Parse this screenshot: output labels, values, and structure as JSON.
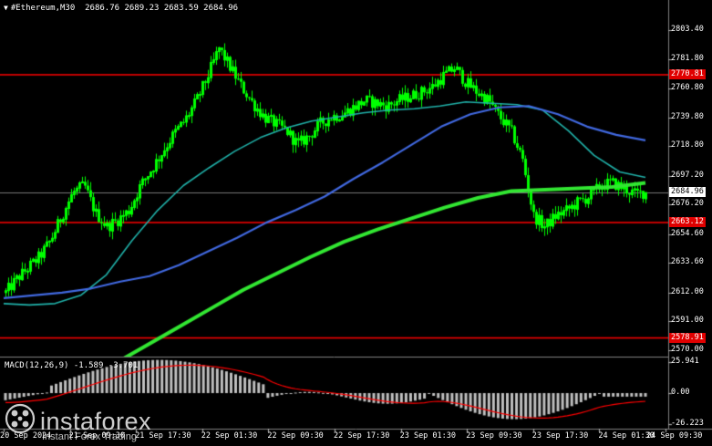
{
  "symbol_bar": {
    "symbol": "#Ethereum,M30",
    "ohlc": "2686.76 2689.23 2683.59 2684.96"
  },
  "macd": {
    "label": "MACD(12,26,9) -1.589 -3.701"
  },
  "price_axis": [
    {
      "value": 2803.4,
      "label": "2803.40"
    },
    {
      "value": 2781.8,
      "label": "2781.80"
    },
    {
      "value": 2760.8,
      "label": "2760.80"
    },
    {
      "value": 2739.8,
      "label": "2739.80"
    },
    {
      "value": 2718.8,
      "label": "2718.80"
    },
    {
      "value": 2697.2,
      "label": "2697.20"
    },
    {
      "value": 2676.2,
      "label": "2676.20"
    },
    {
      "value": 2654.6,
      "label": "2654.60"
    },
    {
      "value": 2633.6,
      "label": "2633.60"
    },
    {
      "value": 2612.0,
      "label": "2612.00"
    },
    {
      "value": 2591.0,
      "label": "2591.00"
    },
    {
      "value": 2570.0,
      "label": "2570.00"
    }
  ],
  "levels": [
    {
      "value": 2770.81,
      "label": "2770.81"
    },
    {
      "value": 2663.12,
      "label": "2663.12"
    },
    {
      "value": 2578.91,
      "label": "2578.91"
    }
  ],
  "current_price": {
    "value": 2684.96,
    "label": "2684.96"
  },
  "macd_axis": [
    {
      "value": 25.941,
      "label": "25.941"
    },
    {
      "value": 0.0,
      "label": "0.00"
    },
    {
      "value": -26.223,
      "label": "-26.223"
    }
  ],
  "time_axis": [
    "20 Sep 2024",
    "21 Sep 09:30",
    "21 Sep 17:30",
    "22 Sep 01:30",
    "22 Sep 09:30",
    "22 Sep 17:30",
    "23 Sep 01:30",
    "23 Sep 09:30",
    "23 Sep 17:30",
    "24 Sep 01:30",
    "24 Sep 09:30"
  ],
  "brand": {
    "name": "instaforex",
    "tagline": "Instant Forex Trading"
  },
  "colors": {
    "background": "#000000",
    "candle": "#00ff00",
    "level_line": "#ff0000",
    "ma_fast": "#20b2aa",
    "ma_mid": "#4169e1",
    "ma_slow": "#32e632",
    "macd_hist": "#c0c0c0",
    "macd_signal": "#ff0000"
  },
  "chart_data": {
    "type": "line",
    "title": "#Ethereum,M30",
    "ylim": [
      2566,
      2816
    ],
    "series": [
      {
        "values": [
          2612,
          2622,
          2630,
          2638,
          2650,
          2668,
          2685,
          2690,
          2670,
          2660,
          2665,
          2672,
          2690,
          2702,
          2715,
          2728,
          2738,
          2752,
          2770,
          2790,
          2776,
          2762,
          2750,
          2740,
          2735,
          2730,
          2720,
          2726,
          2735,
          2740,
          2742,
          2747,
          2752,
          2750,
          2748,
          2752,
          2755,
          2758,
          2762,
          2770,
          2776,
          2765,
          2758,
          2752,
          2740,
          2730,
          2710,
          2668,
          2660,
          2668,
          2672,
          2678,
          2682,
          2690,
          2692,
          2688,
          2684,
          2685
        ]
      },
      {
        "values": [
          2604,
          2603,
          2604,
          2610,
          2625,
          2650,
          2672,
          2690,
          2703,
          2715,
          2725,
          2732,
          2737,
          2740,
          2743,
          2745,
          2746,
          2748,
          2751,
          2750,
          2749,
          2745,
          2730,
          2712,
          2700,
          2696
        ]
      },
      {
        "values": [
          2608,
          2610,
          2612,
          2615,
          2620,
          2624,
          2632,
          2642,
          2652,
          2663,
          2672,
          2682,
          2695,
          2707,
          2720,
          2733,
          2742,
          2747,
          2748,
          2742,
          2733,
          2727,
          2723
        ]
      },
      {
        "values": [
          2558,
          2572,
          2586,
          2600,
          2614,
          2626,
          2638,
          2649,
          2658,
          2666,
          2674,
          2681,
          2686,
          2687,
          2688,
          2689,
          2692
        ]
      }
    ]
  }
}
